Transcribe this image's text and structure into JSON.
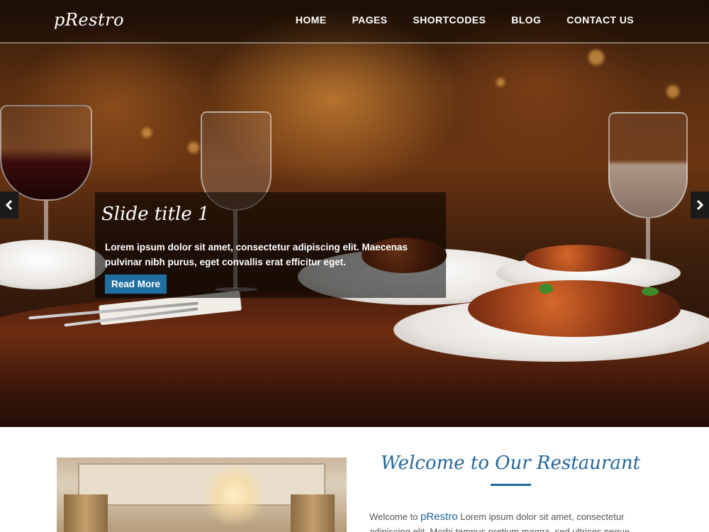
{
  "header": {
    "logo": "pRestro",
    "nav": [
      {
        "label": "HOME"
      },
      {
        "label": "PAGES"
      },
      {
        "label": "SHORTCODES"
      },
      {
        "label": "BLOG"
      },
      {
        "label": "CONTACT US"
      }
    ]
  },
  "slider": {
    "prev_icon": "chevron-left-icon",
    "next_icon": "chevron-right-icon",
    "caption": {
      "title": "Slide title 1",
      "text": "Lorem ipsum dolor sit amet, consectetur adipiscing elit. Maecenas pulvinar nibh purus, eget convallis erat efficitur eget.",
      "button": "Read More"
    }
  },
  "welcome": {
    "title": "Welcome to Our Restaurant",
    "text_before": "Welcome to",
    "brand": "pRestro",
    "text_after": "Lorem ipsum dolor sit amet, consectetur adipiscing elit. Morbi tempus pretium magna, sed ultrices neque commodo sed. Sed"
  },
  "colors": {
    "accent": "#23679a",
    "button": "#1f6fa3",
    "caption_bg": "rgba(0,0,0,0.55)"
  }
}
